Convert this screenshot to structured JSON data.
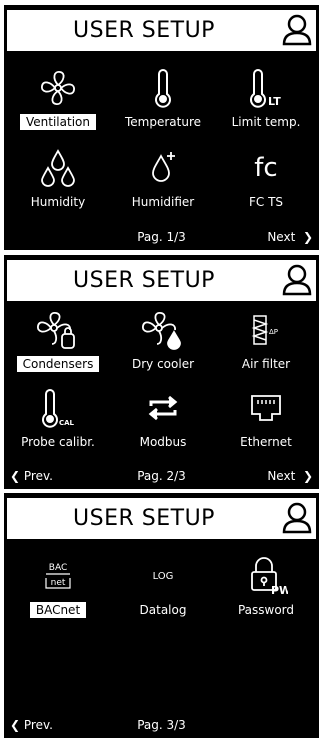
{
  "title": "USER SETUP",
  "screens": [
    {
      "items": [
        {
          "label": "Ventilation",
          "icon": "fan-icon",
          "selected": true
        },
        {
          "label": "Temperature",
          "icon": "thermometer-icon",
          "selected": false
        },
        {
          "label": "Limit temp.",
          "icon": "thermometer-lt-icon",
          "selected": false
        },
        {
          "label": "Humidity",
          "icon": "humidity-drops-icon",
          "selected": false
        },
        {
          "label": "Humidifier",
          "icon": "humidifier-drop-icon",
          "selected": false
        },
        {
          "label": "FC TS",
          "icon": "fc-icon",
          "selected": false
        }
      ],
      "page": "Pag. 1/3",
      "next": "Next",
      "prev": ""
    },
    {
      "items": [
        {
          "label": "Condensers",
          "icon": "fan-condenser-icon",
          "selected": true
        },
        {
          "label": "Dry cooler",
          "icon": "fan-drop-icon",
          "selected": false
        },
        {
          "label": "Air filter",
          "icon": "air-filter-icon",
          "selected": false
        },
        {
          "label": "Probe calibr.",
          "icon": "thermometer-cal-icon",
          "selected": false
        },
        {
          "label": "Modbus",
          "icon": "modbus-arrows-icon",
          "selected": false
        },
        {
          "label": "Ethernet",
          "icon": "ethernet-port-icon",
          "selected": false
        }
      ],
      "page": "Pag. 2/3",
      "next": "Next",
      "prev": "Prev."
    },
    {
      "items": [
        {
          "label": "BACnet",
          "icon": "bacnet-icon",
          "selected": true
        },
        {
          "label": "Datalog",
          "icon": "log-icon",
          "selected": false
        },
        {
          "label": "Password",
          "icon": "padlock-pw-icon",
          "selected": false
        }
      ],
      "page": "Pag. 3/3",
      "next": "",
      "prev": "Prev."
    }
  ],
  "icon_text": {
    "fc": "fc",
    "lt": "LT",
    "cal": "CAL",
    "dp": "ΔP",
    "bac": "BAC",
    "net": "net",
    "log": "LOG",
    "pw": "PW"
  }
}
